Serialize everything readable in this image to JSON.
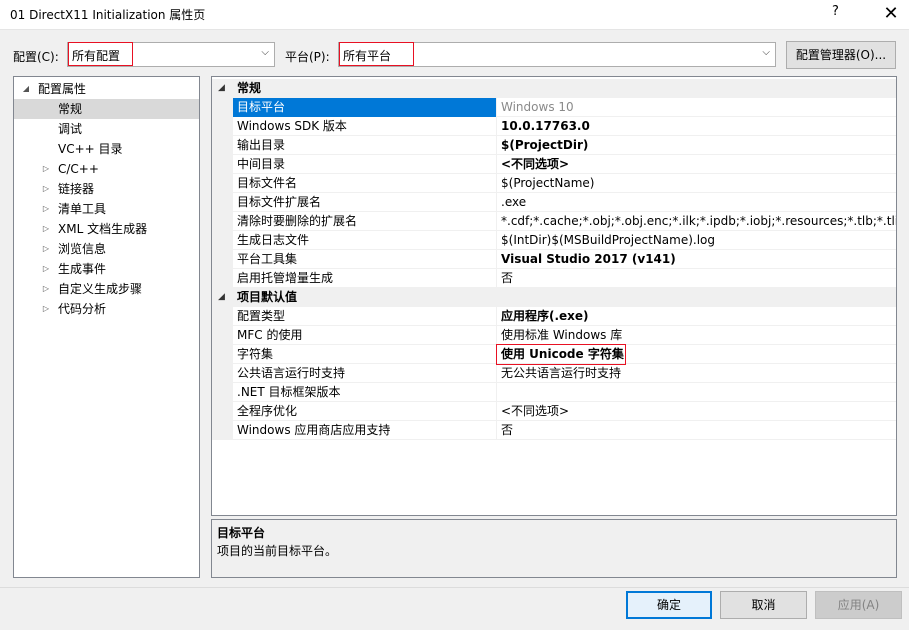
{
  "window": {
    "title": "01 DirectX11 Initialization 属性页",
    "help": "?",
    "close": "✕"
  },
  "toolbar": {
    "config_label": "配置(C):",
    "config_value": "所有配置",
    "platform_label": "平台(P):",
    "platform_value": "所有平台",
    "config_manager": "配置管理器(O)..."
  },
  "tree": {
    "root": "配置属性",
    "items": [
      {
        "label": "常规",
        "selected": true,
        "expandable": false
      },
      {
        "label": "调试",
        "expandable": false
      },
      {
        "label": "VC++ 目录",
        "expandable": false
      },
      {
        "label": "C/C++",
        "expandable": true
      },
      {
        "label": "链接器",
        "expandable": true
      },
      {
        "label": "清单工具",
        "expandable": true
      },
      {
        "label": "XML 文档生成器",
        "expandable": true
      },
      {
        "label": "浏览信息",
        "expandable": true
      },
      {
        "label": "生成事件",
        "expandable": true
      },
      {
        "label": "自定义生成步骤",
        "expandable": true
      },
      {
        "label": "代码分析",
        "expandable": true
      }
    ]
  },
  "grid": {
    "cat_general": "常规",
    "general": [
      {
        "name": "目标平台",
        "value": "Windows 10"
      },
      {
        "name": "Windows SDK 版本",
        "value": "10.0.17763.0"
      },
      {
        "name": "输出目录",
        "value": "$(ProjectDir)"
      },
      {
        "name": "中间目录",
        "value": "<不同选项>"
      },
      {
        "name": "目标文件名",
        "value": "$(ProjectName)"
      },
      {
        "name": "目标文件扩展名",
        "value": ".exe"
      },
      {
        "name": "清除时要删除的扩展名",
        "value": "*.cdf;*.cache;*.obj;*.obj.enc;*.ilk;*.ipdb;*.iobj;*.resources;*.tlb;*.tli;*.tlh;*.tmp;*.rsp;*.pgc;*.pgd"
      },
      {
        "name": "生成日志文件",
        "value": "$(IntDir)$(MSBuildProjectName).log"
      },
      {
        "name": "平台工具集",
        "value": "Visual Studio 2017 (v141)"
      },
      {
        "name": "启用托管增量生成",
        "value": "否"
      }
    ],
    "cat_defaults": "项目默认值",
    "defaults": [
      {
        "name": "配置类型",
        "value": "应用程序(.exe)"
      },
      {
        "name": "MFC 的使用",
        "value": "使用标准 Windows 库"
      },
      {
        "name": "字符集",
        "value": "使用 Unicode 字符集"
      },
      {
        "name": "公共语言运行时支持",
        "value": "无公共语言运行时支持"
      },
      {
        "name": ".NET 目标框架版本",
        "value": ""
      },
      {
        "name": "全程序优化",
        "value": "<不同选项>"
      },
      {
        "name": "Windows 应用商店应用支持",
        "value": "否"
      }
    ]
  },
  "description": {
    "title": "目标平台",
    "text": "项目的当前目标平台。"
  },
  "buttons": {
    "ok": "确定",
    "cancel": "取消",
    "apply": "应用(A)"
  },
  "icons": {
    "expanded": "◢",
    "collapsed": "▷",
    "dropdown": "⌵"
  }
}
